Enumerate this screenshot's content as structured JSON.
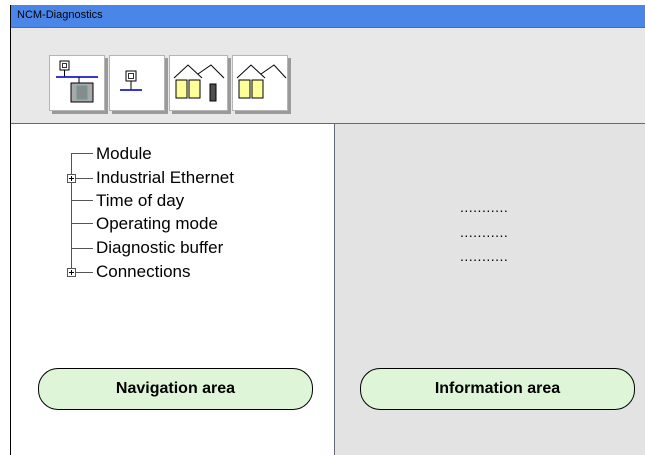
{
  "window": {
    "title": "NCM-Diagnostics"
  },
  "toolbar": {
    "buttons": [
      {
        "icon": "network-module-icon"
      },
      {
        "icon": "network-node-icon"
      },
      {
        "icon": "station-with-module-icon"
      },
      {
        "icon": "station-icon"
      }
    ]
  },
  "navigation": {
    "tree": [
      {
        "label": "Module",
        "expandable": false
      },
      {
        "label": "Industrial Ethernet",
        "expandable": true
      },
      {
        "label": "Time of day",
        "expandable": false
      },
      {
        "label": "Operating mode",
        "expandable": false
      },
      {
        "label": "Diagnostic buffer",
        "expandable": false
      },
      {
        "label": "Connections",
        "expandable": true
      }
    ],
    "area_label": "Navigation area"
  },
  "information": {
    "placeholder_lines": [
      "...........",
      "...........",
      "..........."
    ],
    "area_label": "Information area"
  },
  "colors": {
    "titlebar": "#4a86e8",
    "pill_fill": "#dff5d8",
    "folder_fill": "#ffff99",
    "info_pane_bg": "#e3e3e3"
  }
}
